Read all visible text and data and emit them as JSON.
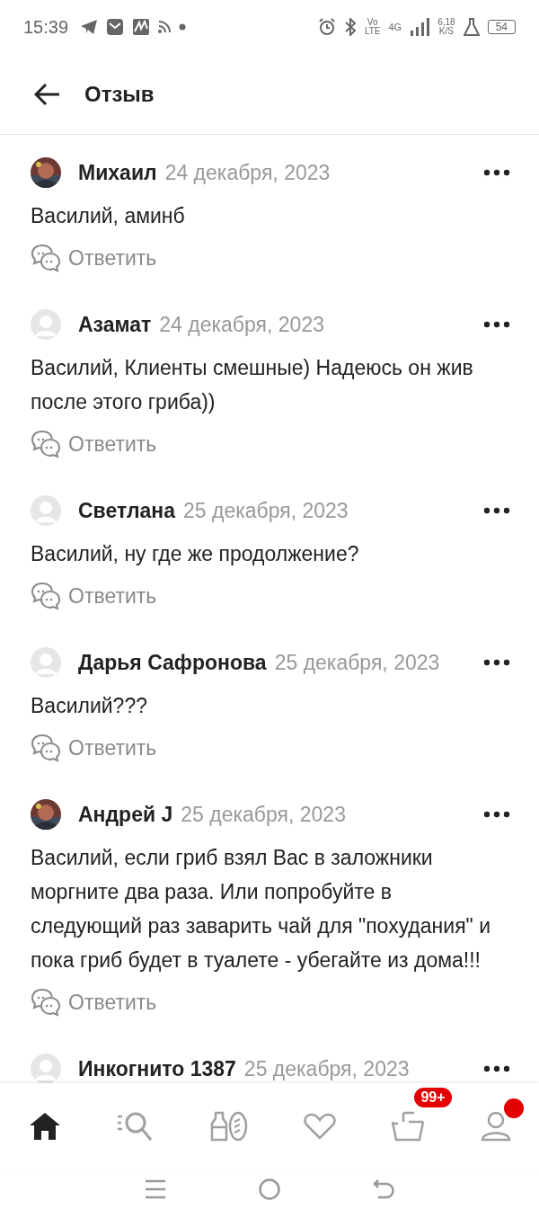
{
  "status_bar": {
    "time": "15:39",
    "volte": [
      "Vo",
      "LTE"
    ],
    "network": "4G",
    "speed": [
      "6,18",
      "K/S"
    ],
    "battery": "54"
  },
  "header": {
    "title": "Отзыв"
  },
  "comments": [
    {
      "author": "Михаил",
      "date": "24 декабря, 2023",
      "text": "Василий, аминб",
      "reply": "Ответить"
    },
    {
      "author": "Азамат",
      "date": "24 декабря, 2023",
      "avatar": {
        "kind": "default"
      },
      "text": "Василий, Клиенты смешные) Надеюсь он жив после этого гриба))",
      "reply": "Ответить"
    },
    {
      "author": "Светлана",
      "date": "25 декабря, 2023",
      "avatar": {
        "kind": "default"
      },
      "text": "Василий, ну где же продолжение?",
      "reply": "Ответить"
    },
    {
      "author": "Дарья Сафронова",
      "date": "25 декабря, 2023",
      "avatar": {
        "kind": "default"
      },
      "text": "Василий???",
      "reply": "Ответить"
    },
    {
      "author": "Андрей J",
      "date": "25 декабря, 2023",
      "text": "Василий, если гриб взял Вас в заложники моргните два раза. Или попробуйте в следующий раз заварить чай для \"похудания\" и пока гриб будет в туалете - убегайте из дома!!!",
      "reply": "Ответить"
    },
    {
      "author": "Инкогнито 1387",
      "date": "25 декабря, 2023",
      "avatar": {
        "kind": "default"
      }
    }
  ],
  "bottom_nav": [
    {
      "kind": "home",
      "selected": true
    },
    {
      "kind": "catalog",
      "selected": false
    },
    {
      "kind": "products",
      "selected": false
    },
    {
      "kind": "favorites",
      "selected": false
    },
    {
      "kind": "cart",
      "selected": false,
      "badge": "99+"
    },
    {
      "kind": "profile",
      "selected": false,
      "dot": true
    }
  ]
}
